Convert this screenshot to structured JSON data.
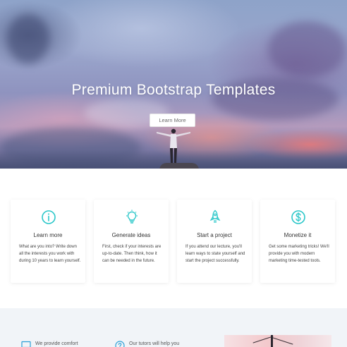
{
  "hero": {
    "title": "Premium Bootstrap Templates",
    "button_label": "Learn More"
  },
  "features": [
    {
      "icon": "info-icon",
      "title": "Learn more",
      "text": "What are you into? Write down all the interests you work with during 10 years to learn yourself."
    },
    {
      "icon": "lightbulb-icon",
      "title": "Generate ideas",
      "text": "First, check if your interests are up-to-date. Then think, how it can be needed in the future."
    },
    {
      "icon": "rocket-icon",
      "title": "Start a project",
      "text": "If you attend our lecture, you'll learn ways to state yourself and start the project successfully."
    },
    {
      "icon": "dollar-icon",
      "title": "Monetize it",
      "text": "Get some marketing tricks! We'll provide you with modern marketing time-tested tools."
    }
  ],
  "bottom": {
    "items": [
      {
        "icon": "monitor-icon",
        "text": "We provide comfort"
      },
      {
        "icon": "help-icon",
        "text": "Our tutors will help you"
      }
    ]
  },
  "colors": {
    "accent": "#2bc7c9",
    "section_bg": "#f1f4f8"
  }
}
